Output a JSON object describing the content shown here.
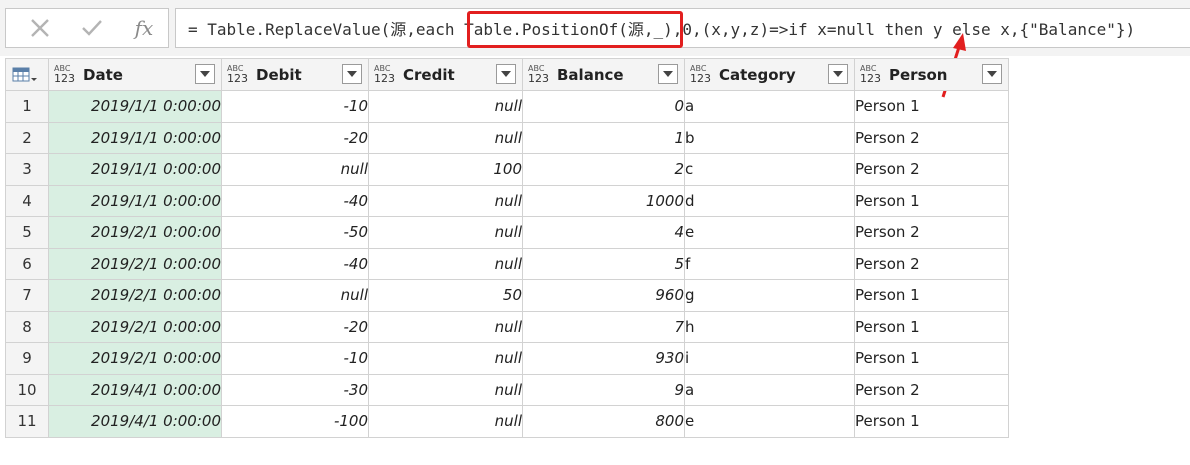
{
  "formula_bar": {
    "cancel_icon": "close-x-icon",
    "confirm_icon": "checkmark-icon",
    "fx_label": "fx",
    "formula": "= Table.ReplaceValue(源,each Table.PositionOf(源,_),0,(x,y,z)=>if x=null then y else x,{\"Balance\"})"
  },
  "annotation": {
    "highlight_color": "#e21f1f"
  },
  "table": {
    "type_label_top": "ABC",
    "type_label_bottom": "123",
    "columns": [
      "Date",
      "Debit",
      "Credit",
      "Balance",
      "Category",
      "Person"
    ],
    "rows": [
      {
        "idx": "1",
        "date": "2019/1/1 0:00:00",
        "debit": "-10",
        "credit": "null",
        "balance": "0",
        "category": "a",
        "person": "Person 1"
      },
      {
        "idx": "2",
        "date": "2019/1/1 0:00:00",
        "debit": "-20",
        "credit": "null",
        "balance": "1",
        "category": "b",
        "person": "Person 2"
      },
      {
        "idx": "3",
        "date": "2019/1/1 0:00:00",
        "debit": "null",
        "credit": "100",
        "balance": "2",
        "category": "c",
        "person": "Person 2"
      },
      {
        "idx": "4",
        "date": "2019/1/1 0:00:00",
        "debit": "-40",
        "credit": "null",
        "balance": "1000",
        "category": "d",
        "person": "Person 1"
      },
      {
        "idx": "5",
        "date": "2019/2/1 0:00:00",
        "debit": "-50",
        "credit": "null",
        "balance": "4",
        "category": "e",
        "person": "Person 2"
      },
      {
        "idx": "6",
        "date": "2019/2/1 0:00:00",
        "debit": "-40",
        "credit": "null",
        "balance": "5",
        "category": "f",
        "person": "Person 2"
      },
      {
        "idx": "7",
        "date": "2019/2/1 0:00:00",
        "debit": "null",
        "credit": "50",
        "balance": "960",
        "category": "g",
        "person": "Person 1"
      },
      {
        "idx": "8",
        "date": "2019/2/1 0:00:00",
        "debit": "-20",
        "credit": "null",
        "balance": "7",
        "category": "h",
        "person": "Person 1"
      },
      {
        "idx": "9",
        "date": "2019/2/1 0:00:00",
        "debit": "-10",
        "credit": "null",
        "balance": "930",
        "category": "i",
        "person": "Person 1"
      },
      {
        "idx": "10",
        "date": "2019/4/1 0:00:00",
        "debit": "-30",
        "credit": "null",
        "balance": "9",
        "category": "a",
        "person": "Person 2"
      },
      {
        "idx": "11",
        "date": "2019/4/1 0:00:00",
        "debit": "-100",
        "credit": "null",
        "balance": "800",
        "category": "e",
        "person": "Person 1"
      }
    ]
  }
}
